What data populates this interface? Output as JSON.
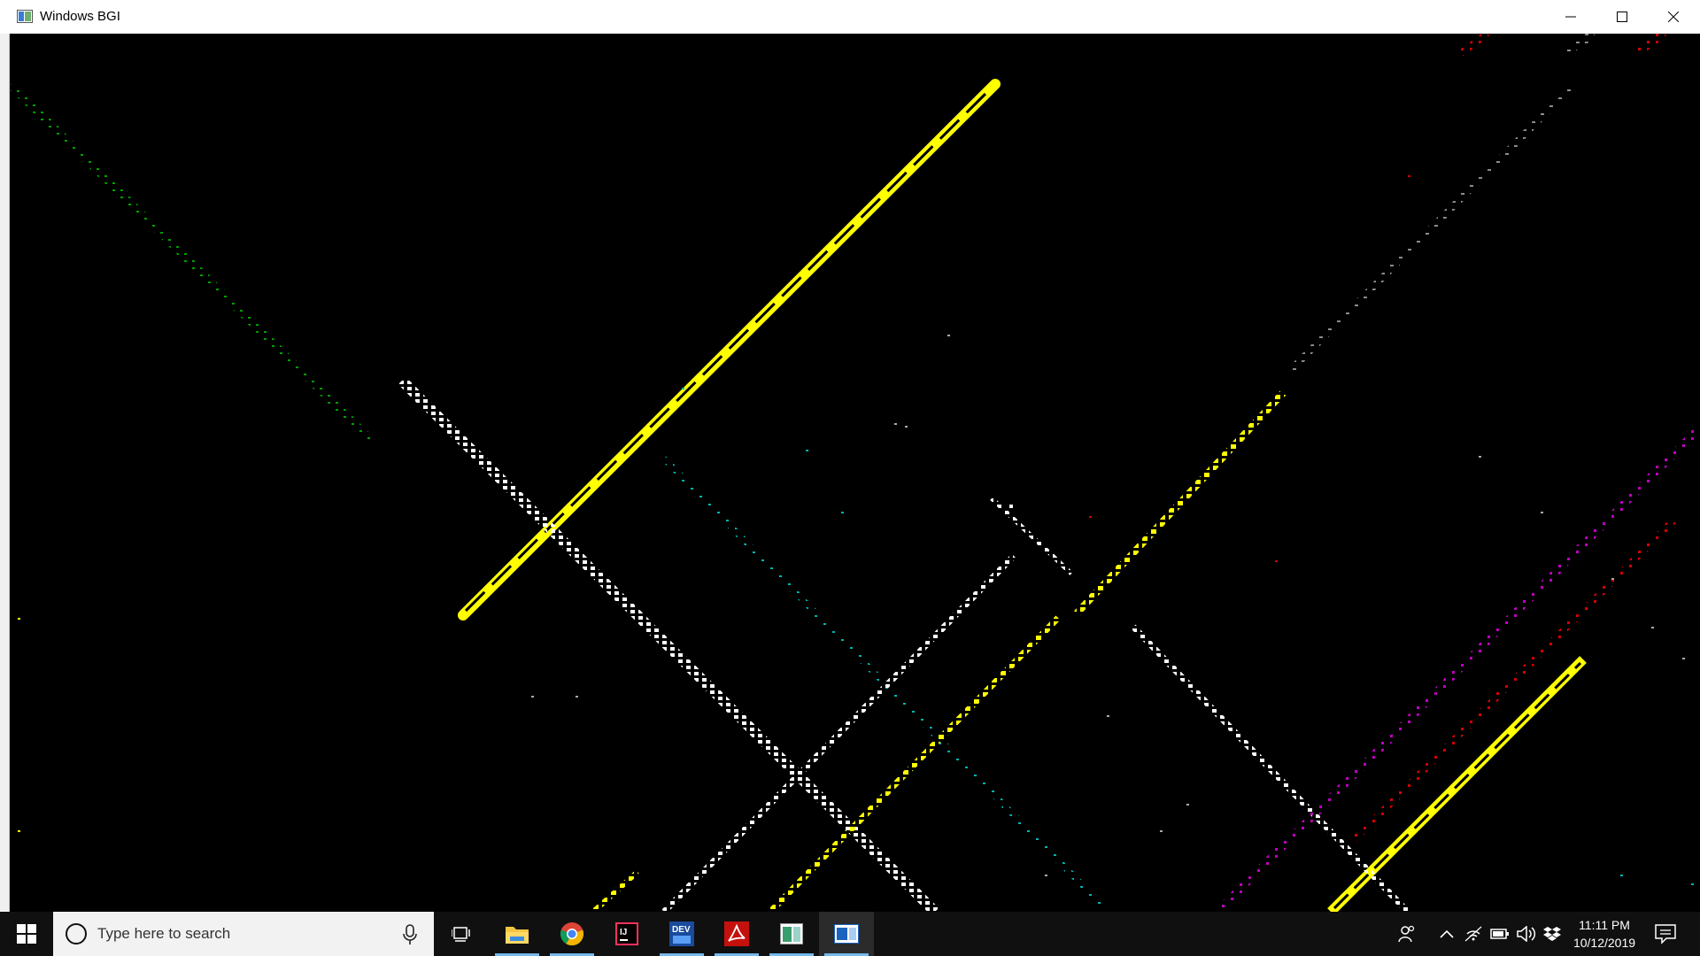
{
  "window": {
    "title": "Windows BGI",
    "icon": "app-window-icon",
    "controls": [
      "minimize-icon",
      "maximize-icon",
      "close-icon"
    ]
  },
  "canvas": {
    "background": "#000000",
    "line_colors": {
      "yellow": "#ffff00",
      "white": "#ffffff",
      "green": "#00a000",
      "cyan": "#00b4b4",
      "magenta": "#c000c0",
      "red": "#d40000",
      "gray": "#8c8c8c"
    }
  },
  "taskbar": {
    "search": {
      "placeholder": "Type here to search"
    },
    "apps": [
      {
        "name": "task-view-icon"
      },
      {
        "name": "file-explorer-icon"
      },
      {
        "name": "chrome-icon"
      },
      {
        "name": "intellij-icon"
      },
      {
        "name": "devcpp-icon",
        "label": "DEV"
      },
      {
        "name": "acrobat-icon"
      },
      {
        "name": "app-window-icon"
      },
      {
        "name": "windows-bgi-icon"
      }
    ],
    "tray": [
      "people-icon",
      "chevron-up-icon",
      "wifi-icon",
      "battery-icon",
      "volume-icon",
      "dropbox-icon"
    ],
    "clock": {
      "time": "11:11 PM",
      "date": "10/12/2019"
    },
    "notification": "action-center-icon",
    "accent": "#76b9ed"
  }
}
